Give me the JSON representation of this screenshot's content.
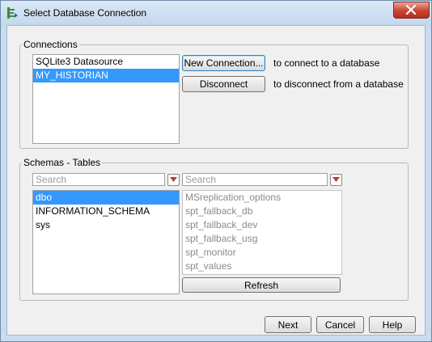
{
  "window": {
    "title": "Select Database Connection"
  },
  "connections": {
    "legend": "Connections",
    "items": [
      {
        "label": "SQLite3 Datasource",
        "selected": false
      },
      {
        "label": "MY_HISTORIAN",
        "selected": true
      }
    ],
    "new_button": "New Connection...",
    "new_desc": "to connect to a database",
    "disconnect_button": "Disconnect",
    "disconnect_desc": "to disconnect from a database"
  },
  "schemas_tables": {
    "legend": "Schemas - Tables",
    "schema_search_placeholder": "Search",
    "table_search_placeholder": "Search",
    "schemas": [
      {
        "label": "dbo",
        "selected": true
      },
      {
        "label": "INFORMATION_SCHEMA",
        "selected": false
      },
      {
        "label": "sys",
        "selected": false
      }
    ],
    "tables": [
      "MSreplication_options",
      "spt_fallback_db",
      "spt_fallback_dev",
      "spt_fallback_usg",
      "spt_monitor",
      "spt_values"
    ],
    "refresh_button": "Refresh"
  },
  "footer": {
    "next": "Next",
    "cancel": "Cancel",
    "help": "Help"
  },
  "colors": {
    "selection": "#3399ff",
    "close_button": "#c9442f",
    "dropdown_arrow": "#c0392b"
  }
}
